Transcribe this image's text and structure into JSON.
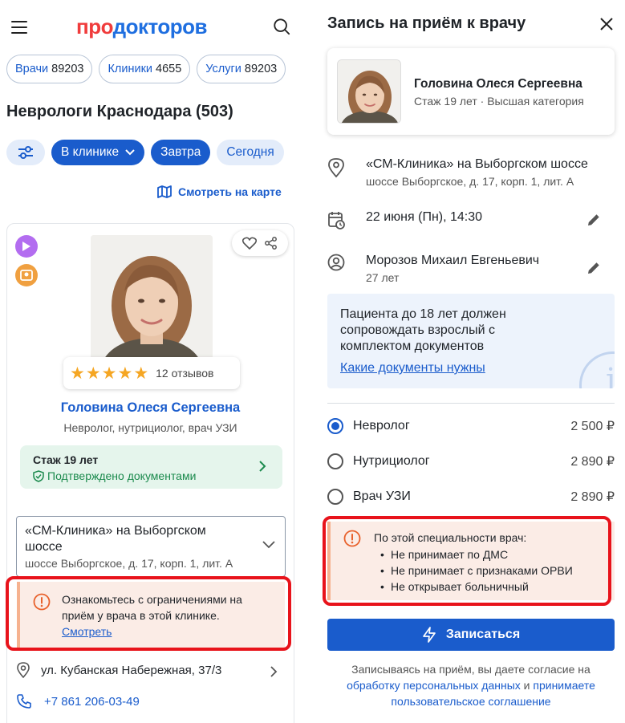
{
  "colors": {
    "accent": "#1a5ccc",
    "logo_red": "#f03c3c",
    "warning_bg": "#fbece6",
    "highlight_frame": "#e8131b",
    "success": "#1b8a4d"
  },
  "header": {
    "logo_part1": "про",
    "logo_part2": "докторов",
    "menu_icon": "hamburger-icon",
    "search_icon": "search-icon"
  },
  "chips": [
    {
      "label": "Врачи",
      "count": "89203"
    },
    {
      "label": "Клиники",
      "count": "4655"
    },
    {
      "label": "Услуги",
      "count": "89203"
    }
  ],
  "page_title": "Неврологи Краснодара (503)",
  "filters": {
    "clinic": "В клинике",
    "tomorrow": "Завтра",
    "today": "Сегодня"
  },
  "map_link": "Смотреть на карте",
  "doctor_card": {
    "reviews": "12 отзывов",
    "rating_stars": 5,
    "name": "Головина Олеся Сергеевна",
    "specialties": "Невролог, нутрициолог, врач УЗИ",
    "experience": "Стаж 19 лет",
    "verified": "Подтверждено документами",
    "clinic_name": "«СМ-Клиника» на Выборгском шоссе",
    "clinic_address": "шоссе Выборгское, д. 17, корп. 1, лит. А",
    "warning_text": "Ознакомьтесь с ограничениями на приём у врача в этой клинике.",
    "warning_link": "Смотреть",
    "address": "ул. Кубанская Набережная, 37/3",
    "phone": "+7 861 206-03-49"
  },
  "modal": {
    "title": "Запись на приём к врачу",
    "doctor_name": "Головина Олеся Сергеевна",
    "doctor_meta": "Стаж 19 лет · Высшая категория",
    "clinic_name": "«СМ-Клиника» на Выборгском шоссе",
    "clinic_address": "шоссе Выборгское, д. 17, корп. 1, лит. А",
    "datetime": "22 июня (Пн), 14:30",
    "patient_name": "Морозов Михаил Евгеньевич",
    "patient_age": "27 лет",
    "notice_text": "Пациента до 18 лет должен сопровождать взрослый с комплектом документов",
    "notice_link": "Какие документы нужны",
    "specialties": [
      {
        "name": "Невролог",
        "price": "2 500 ₽",
        "selected": true
      },
      {
        "name": "Нутрициолог",
        "price": "2 890 ₽",
        "selected": false
      },
      {
        "name": "Врач УЗИ",
        "price": "2 890 ₽",
        "selected": false
      }
    ],
    "warning_title": "По этой специальности врач:",
    "warning_items": [
      "Не принимает по ДМС",
      "Не принимает с признаками ОРВИ",
      "Не открывает больничный"
    ],
    "submit": "Записаться",
    "consent_pre": "Записываясь на приём, вы даете согласие на",
    "consent_link1": "обработку персональных данных",
    "consent_and": "и",
    "consent_link2": "принимаете пользовательское соглашение"
  }
}
